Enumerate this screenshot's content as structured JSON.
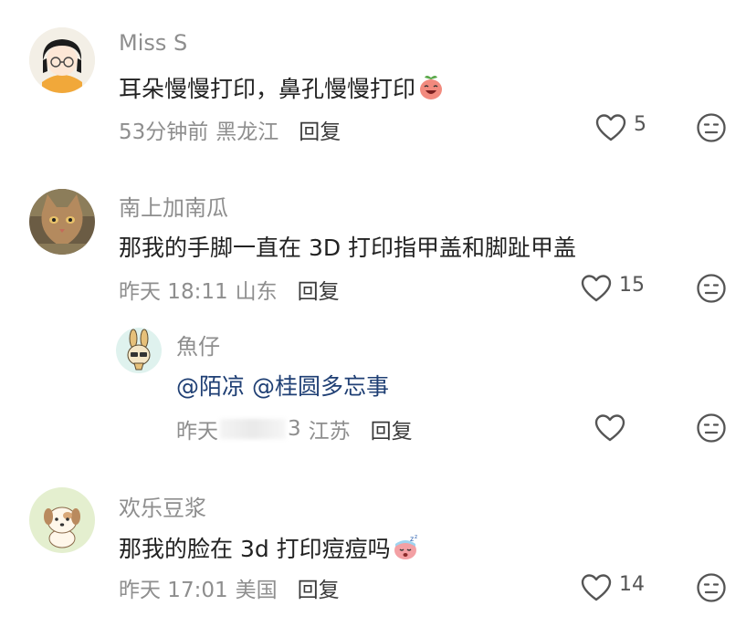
{
  "comments": [
    {
      "username": "Miss S",
      "text": "耳朵慢慢打印，鼻孔慢慢打印",
      "emoji": "laughing-peach-emoji",
      "meta_time": "53分钟前",
      "meta_location": "黑龙江",
      "reply_label": "回复",
      "likes": "5"
    },
    {
      "username": "南上加南瓜",
      "text": "那我的手脚一直在 3D 打印指甲盖和脚趾甲盖",
      "meta_time": "昨天 18:11",
      "meta_location": "山东",
      "reply_label": "回复",
      "likes": "15"
    },
    {
      "username": "魚仔",
      "mention_1": "@陌凉",
      "mention_2": "@桂圆多忘事",
      "meta_time_prefix": "昨天",
      "meta_time_suffix": "3",
      "meta_location": "江苏",
      "reply_label": "回复",
      "likes": ""
    },
    {
      "username": "欢乐豆浆",
      "text": "那我的脸在 3d 打印痘痘吗",
      "emoji": "sleepy-peach-emoji",
      "meta_time": "昨天 17:01",
      "meta_location": "美国",
      "reply_label": "回复",
      "likes": "14"
    }
  ],
  "colors": {
    "username": "#8e8e8e",
    "mention": "#1f3f74",
    "icon": "#555555"
  }
}
